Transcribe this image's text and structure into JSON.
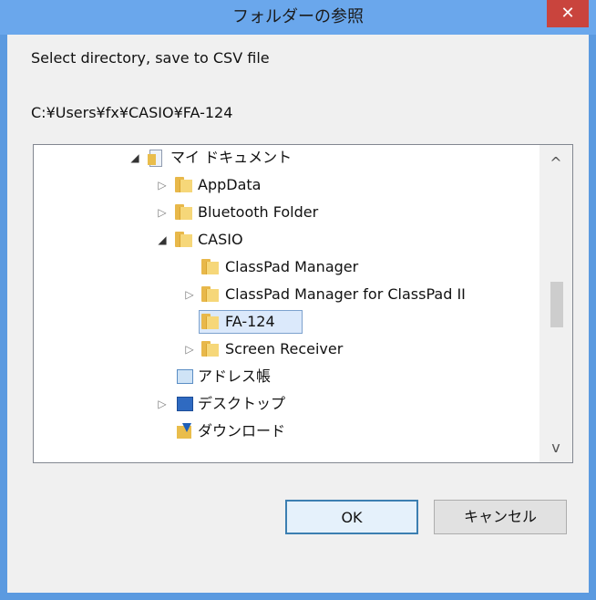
{
  "window": {
    "title": "フォルダーの参照",
    "close_symbol": "✕"
  },
  "dialog": {
    "description": "Select directory, save to CSV file",
    "current_path": "C:¥Users¥fx¥CASIO¥FA-124"
  },
  "tree": {
    "items": [
      {
        "label": "マイ ドキュメント",
        "expander": "◢",
        "icon": "documents-folder-icon"
      },
      {
        "label": "AppData",
        "expander": "▷",
        "icon": "folder-icon"
      },
      {
        "label": "Bluetooth Folder",
        "expander": "▷",
        "icon": "folder-icon"
      },
      {
        "label": "CASIO",
        "expander": "◢",
        "icon": "folder-icon"
      },
      {
        "label": "ClassPad Manager",
        "expander": "",
        "icon": "folder-icon"
      },
      {
        "label": "ClassPad Manager for ClassPad II",
        "expander": "▷",
        "icon": "folder-icon"
      },
      {
        "label": "FA-124",
        "expander": "",
        "icon": "folder-icon",
        "selected": true
      },
      {
        "label": "Screen Receiver",
        "expander": "▷",
        "icon": "folder-icon"
      },
      {
        "label": "アドレス帳",
        "expander": "",
        "icon": "address-book-icon"
      },
      {
        "label": "デスクトップ",
        "expander": "▷",
        "icon": "desktop-folder-icon"
      },
      {
        "label": "ダウンロード",
        "expander": "",
        "icon": "downloads-folder-icon"
      }
    ],
    "scroll_up": "^",
    "scroll_down": "v"
  },
  "buttons": {
    "ok": "OK",
    "cancel": "キャンセル"
  },
  "colors": {
    "title_bar": "#6aa7ec",
    "close": "#c9443d",
    "selection": "#dbe9fb"
  }
}
